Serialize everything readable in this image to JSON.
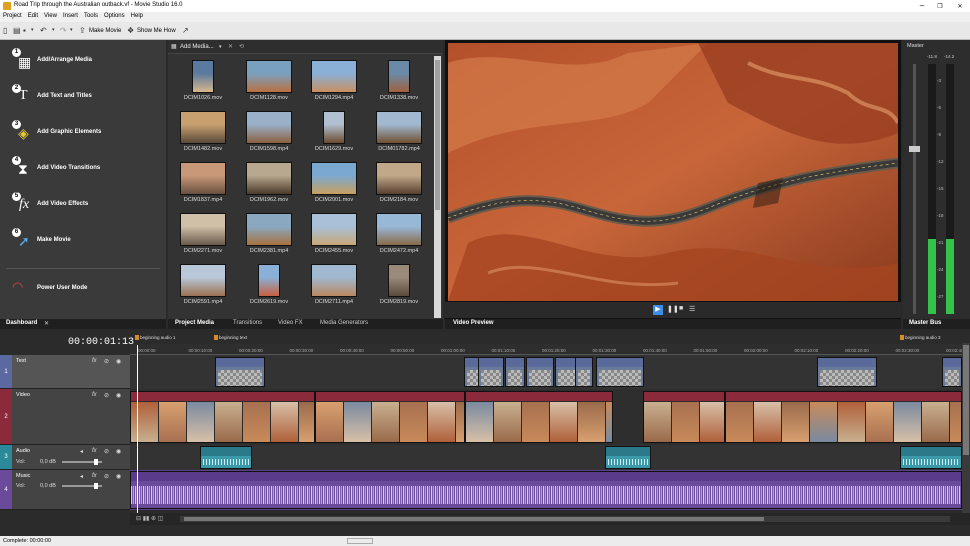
{
  "window": {
    "title": "Road Trip through the Australian outback.vf - Movie Studio 16.0",
    "controls": [
      "–",
      "❐",
      "✕"
    ]
  },
  "menu": [
    "Project",
    "Edit",
    "View",
    "Insert",
    "Tools",
    "Options",
    "Help"
  ],
  "toolbar": {
    "make_movie": "Make Movie",
    "show_me_how": "Show Me How"
  },
  "dashboard": {
    "items": [
      {
        "label": "Add/Arrange Media",
        "num": "1"
      },
      {
        "label": "Add Text and Titles",
        "num": "2"
      },
      {
        "label": "Add Graphic Elements",
        "num": "3"
      },
      {
        "label": "Add Video Transitions",
        "num": "4"
      },
      {
        "label": "Add Video Effects",
        "num": "5"
      },
      {
        "label": "Make Movie",
        "num": "6"
      }
    ],
    "power_user": "Power User Mode",
    "tab": "Dashboard",
    "tab_close": "✕"
  },
  "media": {
    "add_media": "Add Media...",
    "files": [
      "DCIM1026.mov",
      "DCIM1128.mov",
      "DCIM1294.mp4",
      "DCIM1338.mov",
      "DCIM1482.mov",
      "DCIM1598.mp4",
      "DCIM1629.mov",
      "DCIM01782.mp4",
      "DCIM1837.mp4",
      "DCIM1962.mov",
      "DCIM2001.mov",
      "DCIM2184.mov",
      "DCIM2271.mov",
      "DCIM2381.mp4",
      "DCIM2455.mov",
      "DCIM2472.mp4",
      "DCIM2591.mp4",
      "DCIM2619.mov",
      "DCIM2711.mp4",
      "DCIM2819.mov"
    ],
    "tabs": [
      "Project Media",
      "Transitions",
      "Video FX",
      "Media Generators"
    ]
  },
  "preview": {
    "tab": "Video Preview"
  },
  "master": {
    "title": "Master",
    "peak_left": "-11.8",
    "peak_right": "-14.2",
    "scale": [
      "3",
      "6",
      "9",
      "12",
      "15",
      "18",
      "21",
      "24",
      "27"
    ],
    "level_left": 0.3,
    "level_right": 0.3,
    "tab": "Master Bus"
  },
  "timeline": {
    "timecode": "00:00:01:13",
    "ruler": [
      "00:00:00",
      "00:00:10:00",
      "00:00:20:00",
      "00:00:30:00",
      "00:00:40:00",
      "00:00:50:00",
      "00:01:00:00",
      "00:01:10:00",
      "00:01:20:00",
      "00:01:30:00",
      "00:01:40:00",
      "00:01:50:00",
      "00:02:00:00",
      "00:02:10:00",
      "00:02:20:00",
      "00:02:30:00",
      "00:02:40:00"
    ],
    "markers": [
      "beginning audio 1",
      "beginning text",
      "beginning audio 3"
    ],
    "tracks": [
      {
        "num": "1",
        "name": "Text"
      },
      {
        "num": "2",
        "name": "Video"
      },
      {
        "num": "3",
        "name": "Audio",
        "vol": "Vol:",
        "db": "0,0 dB"
      },
      {
        "num": "4",
        "name": "Music",
        "vol": "Vol:",
        "db": "0,0 dB"
      }
    ]
  },
  "status": "Complete: 00:00:00",
  "colors": {
    "text_track": "#5a5a5a",
    "video_track": "#8a2a3a",
    "audio_track": "#2a8a9a",
    "music_track": "#6a4a9a",
    "accent": "#3a8ee6"
  }
}
